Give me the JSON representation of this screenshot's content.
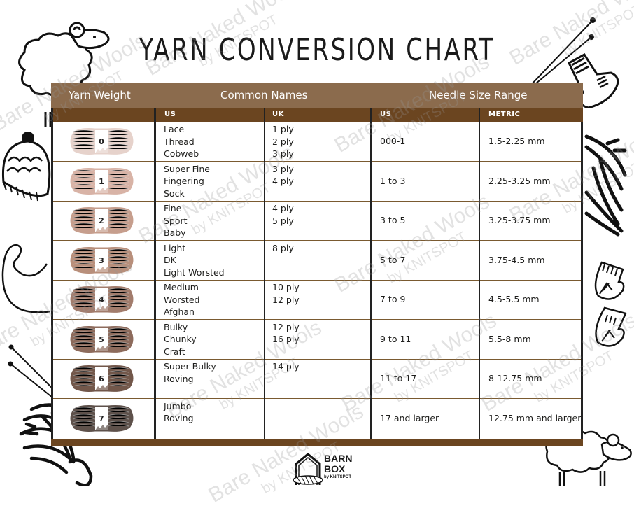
{
  "title": "YARN CONVERSION CHART",
  "header": {
    "yarn_weight": "Yarn Weight",
    "common_names": "Common Names",
    "needle_size_range": "Needle Size Range",
    "sub_us_names": "US",
    "sub_uk_names": "UK",
    "sub_us_needle": "US",
    "sub_metric": "METRIC"
  },
  "colors": {
    "header_light": "#8b6b4d",
    "header_dark": "#6b4520",
    "row_divider": "#7a5a30"
  },
  "rows": [
    {
      "weight": "0",
      "us_names": [
        "Lace",
        "Thread",
        "Cobweb"
      ],
      "uk_names": [
        "1 ply",
        "2 ply",
        "3 ply"
      ],
      "us_needle": "000-1",
      "metric": "1.5-2.25 mm",
      "skein_color": "#e6d2cb"
    },
    {
      "weight": "1",
      "us_names": [
        "Super Fine",
        "Fingering",
        "Sock"
      ],
      "uk_names": [
        "3 ply",
        "4 ply"
      ],
      "us_needle": "1 to 3",
      "metric": "2.25-3.25 mm",
      "skein_color": "#d8b3a6"
    },
    {
      "weight": "2",
      "us_names": [
        "Fine",
        "Sport",
        "Baby"
      ],
      "uk_names": [
        "4 ply",
        "5 ply"
      ],
      "us_needle": "3 to 5",
      "metric": "3.25-3.75 mm",
      "skein_color": "#c69e8d"
    },
    {
      "weight": "3",
      "us_names": [
        "Light",
        "DK",
        "Light Worsted"
      ],
      "uk_names": [
        "8 ply"
      ],
      "us_needle": "5 to 7",
      "metric": "3.75-4.5 mm",
      "skein_color": "#b88f7b"
    },
    {
      "weight": "4",
      "us_names": [
        "Medium",
        "Worsted",
        "Afghan"
      ],
      "uk_names": [
        "10 ply",
        "12 ply"
      ],
      "us_needle": "7 to 9",
      "metric": "4.5-5.5 mm",
      "skein_color": "#a27c6c"
    },
    {
      "weight": "5",
      "us_names": [
        "Bulky",
        "Chunky",
        "Craft"
      ],
      "uk_names": [
        "12 ply",
        "16 ply"
      ],
      "us_needle": "9 to 11",
      "metric": "5.5-8 mm",
      "skein_color": "#8d6b5c"
    },
    {
      "weight": "6",
      "us_names": [
        "Super Bulky",
        "Roving"
      ],
      "uk_names": [
        "14 ply"
      ],
      "us_needle": "11 to 17",
      "metric": "8-12.75 mm",
      "skein_color": "#72574a"
    },
    {
      "weight": "7",
      "us_names": [
        "Jumbo",
        "Roving"
      ],
      "uk_names": [],
      "us_needle": "17 and larger",
      "metric": "12.75 mm and larger",
      "skein_color": "#5e514b"
    }
  ],
  "watermark": {
    "line1": "Bare Naked Wools",
    "line2": "by KNITSPOT"
  },
  "logo": {
    "line1": "BARN",
    "line2": "BOX",
    "line3": "by KNITSPOT"
  },
  "icons": [
    "sheep-icon",
    "knitting-needles-icon",
    "sock-icon",
    "beanie-hat-icon",
    "yarn-strand-icon",
    "yarn-ball-icon",
    "mittens-icon",
    "yarn-skein-icon",
    "barn-icon"
  ]
}
